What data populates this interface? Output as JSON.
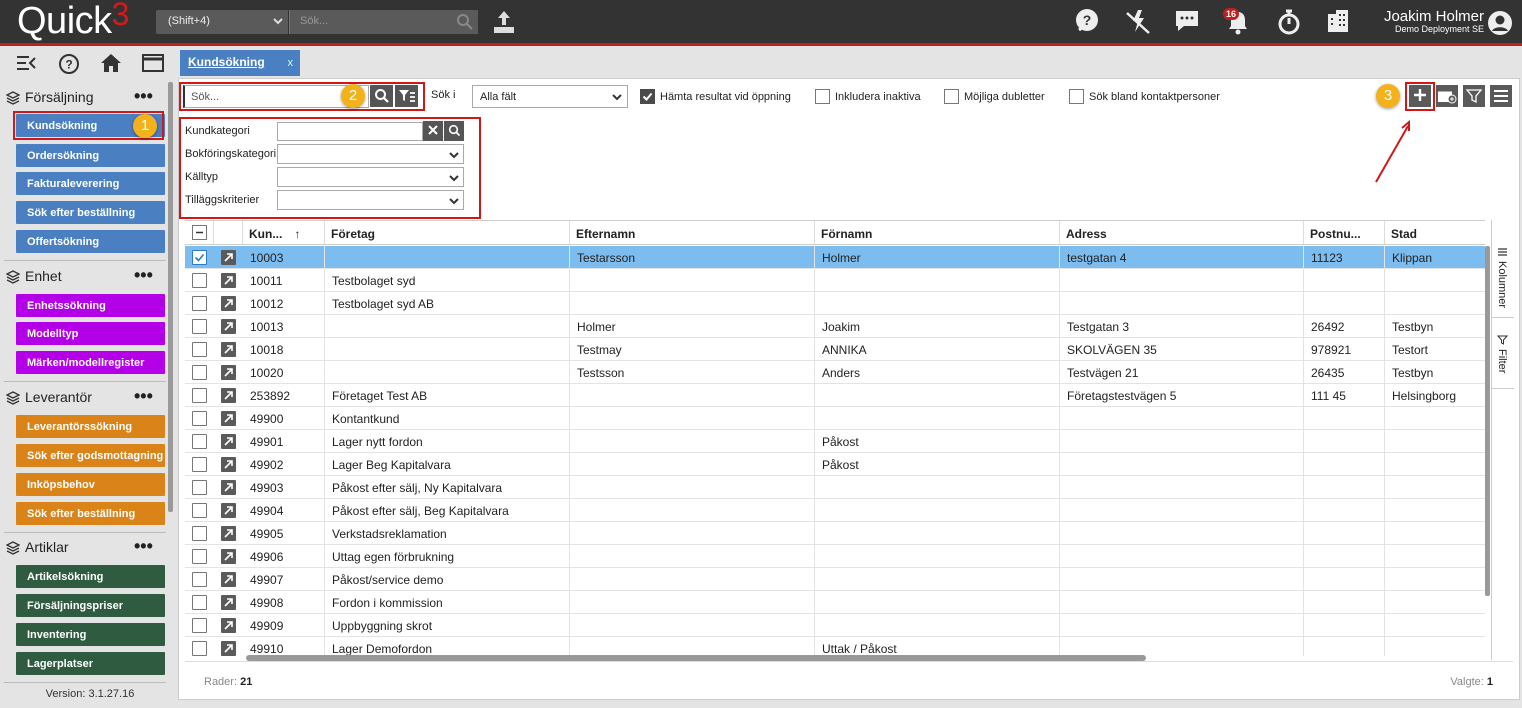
{
  "app": {
    "logo_text": "Quick",
    "logo_suffix": "3"
  },
  "topbar": {
    "shortcut_value": "(Shift+4)",
    "search_placeholder": "Sök...",
    "notification_count": "16",
    "user_name": "Joakim Holmer",
    "user_deployment": "Demo Deployment SE"
  },
  "tab": {
    "label": "Kundsökning",
    "close": "x"
  },
  "sidebar": {
    "sections": [
      {
        "title": "Försäljning",
        "items": [
          "Kundsökning",
          "Ordersökning",
          "Fakturaleverering",
          "Sök efter beställning",
          "Offertsökning"
        ]
      },
      {
        "title": "Enhet",
        "items": [
          "Enhetssökning",
          "Modelltyp",
          "Märken/modellregister"
        ]
      },
      {
        "title": "Leverantör",
        "items": [
          "Leverantörssökning",
          "Sök efter godsmottagning",
          "Inköpsbehov",
          "Sök efter beställning"
        ]
      },
      {
        "title": "Artiklar",
        "items": [
          "Artikelsökning",
          "Försäljningspriser",
          "Inventering",
          "Lagerplatser"
        ]
      }
    ],
    "more": "•••",
    "version": "Version: 3.1.27.16"
  },
  "callouts": [
    "1",
    "2",
    "3"
  ],
  "search": {
    "placeholder": "Sök...",
    "sok_i_label": "Sök i",
    "sok_i_value": "Alla fält",
    "options": [
      {
        "label": "Hämta resultat vid öppning",
        "checked": true
      },
      {
        "label": "Inkludera inaktiva",
        "checked": false
      },
      {
        "label": "Möjliga dubletter",
        "checked": false
      },
      {
        "label": "Sök bland kontaktpersoner",
        "checked": false
      }
    ]
  },
  "filters": [
    "Kundkategori",
    "Bokföringskategori",
    "Källtyp",
    "Tilläggskriterier"
  ],
  "grid": {
    "columns": [
      "Kun...",
      "Företag",
      "Efternamn",
      "Förnamn",
      "Adress",
      "Postnu...",
      "Stad"
    ],
    "sort_indicator": "↑",
    "rows": [
      [
        "10003",
        "",
        "Testarsson",
        "Holmer",
        "testgatan 4",
        "11123",
        "Klippan"
      ],
      [
        "10011",
        "Testbolaget syd",
        "",
        "",
        "",
        "",
        ""
      ],
      [
        "10012",
        "Testbolaget syd AB",
        "",
        "",
        "",
        "",
        ""
      ],
      [
        "10013",
        "",
        "Holmer",
        "Joakim",
        "Testgatan 3",
        "26492",
        "Testbyn"
      ],
      [
        "10018",
        "",
        "Testmay",
        "ANNIKA",
        "SKOLVÄGEN 35",
        "978921",
        "Testort"
      ],
      [
        "10020",
        "",
        "Testsson",
        "Anders",
        "Testvägen 21",
        "26435",
        "Testbyn"
      ],
      [
        "253892",
        "Företaget Test AB",
        "",
        "",
        "Företagstestvägen 5",
        "111 45",
        "Helsingborg"
      ],
      [
        "49900",
        "Kontantkund",
        "",
        "",
        "",
        "",
        ""
      ],
      [
        "49901",
        "Lager nytt fordon",
        "",
        "Påkost",
        "",
        "",
        ""
      ],
      [
        "49902",
        "Lager Beg Kapitalvara",
        "",
        "Påkost",
        "",
        "",
        ""
      ],
      [
        "49903",
        "Påkost efter sälj, Ny Kapitalvara",
        "",
        "",
        "",
        "",
        ""
      ],
      [
        "49904",
        "Påkost efter sälj, Beg Kapitalvara",
        "",
        "",
        "",
        "",
        ""
      ],
      [
        "49905",
        "Verkstadsreklamation",
        "",
        "",
        "",
        "",
        ""
      ],
      [
        "49906",
        "Uttag egen förbrukning",
        "",
        "",
        "",
        "",
        ""
      ],
      [
        "49907",
        "Påkost/service demo",
        "",
        "",
        "",
        "",
        ""
      ],
      [
        "49908",
        "Fordon i kommission",
        "",
        "",
        "",
        "",
        ""
      ],
      [
        "49909",
        "Uppbyggning skrot",
        "",
        "",
        "",
        "",
        ""
      ],
      [
        "49910",
        "Lager Demofordon",
        "",
        "Uttak / Påkost",
        "",
        "",
        ""
      ]
    ],
    "selected_row": 0
  },
  "side_panel": {
    "columns": "Kolumner",
    "filter": "Filter"
  },
  "footer": {
    "rows_label": "Rader:",
    "rows_value": "21",
    "selected_label": "Valgte:",
    "selected_value": "1"
  },
  "colors": {
    "blue": "#4a7fc1",
    "purple": "#b400e6",
    "orange": "#d98318",
    "green": "#2f5c41",
    "highlight": "#d01818",
    "callout": "#f3b21b"
  }
}
